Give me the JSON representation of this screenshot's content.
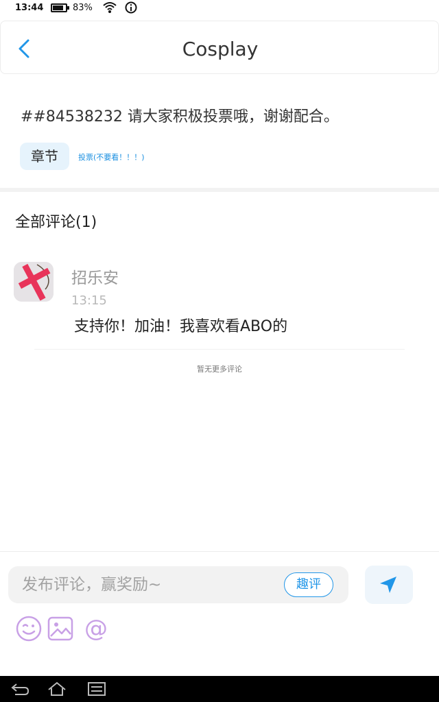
{
  "status": {
    "time": "13:44",
    "battery_percent": "83%",
    "battery_level": 0.83
  },
  "header": {
    "title": "Cosplay"
  },
  "post": {
    "content": "##84538232 请大家积极投票哦，谢谢配合。",
    "tag": "章节",
    "chapter_label": "投票(不要看！！！)"
  },
  "comments": {
    "title": "全部评论(1)",
    "items": [
      {
        "username": "招乐安",
        "time": "13:15",
        "text": "支持你！加油！我喜欢看ABO的"
      }
    ],
    "no_more": "暂无更多评论"
  },
  "composer": {
    "placeholder": "发布评论，赢奖励~",
    "quping_label": "趣评"
  },
  "colors": {
    "accent": "#2196e8",
    "icon_purple": "#c8a0e6"
  }
}
